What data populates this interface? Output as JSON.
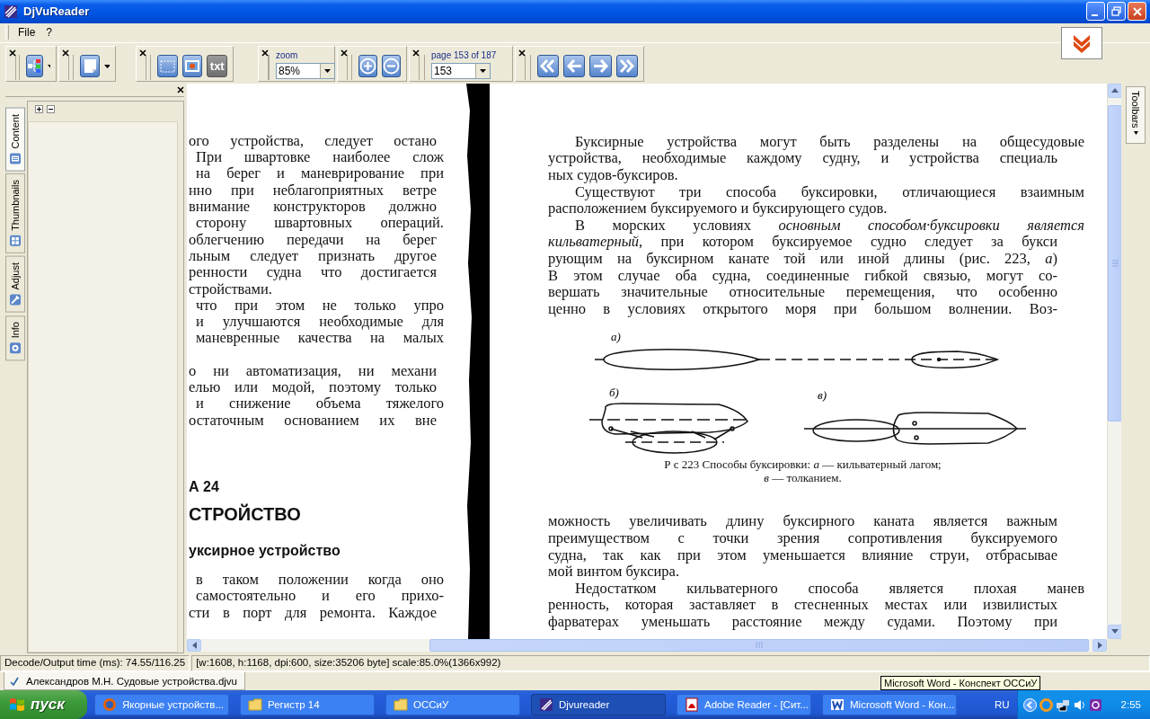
{
  "window": {
    "title": "DjVuReader"
  },
  "menu": [
    "File",
    "?"
  ],
  "toolbar": {
    "text_button": "txt",
    "zoom": {
      "label": "zoom",
      "value": "85%"
    },
    "page": {
      "label": "page 153 of 187",
      "value": "153"
    }
  },
  "sidebar": {
    "tabs": [
      {
        "label": "Content",
        "selected": true
      },
      {
        "label": "Thumbnails",
        "selected": false
      },
      {
        "label": "Adjust",
        "selected": false
      },
      {
        "label": "Info",
        "selected": false
      }
    ]
  },
  "right_tab": "Toolbars",
  "left_page": {
    "lines": [
      {
        "kind": "line",
        "text": "ого устройства, следует остано"
      },
      {
        "kind": "indent",
        "text": "При швартовке наиболее слож"
      },
      {
        "kind": "indent",
        "text": "на берег и маневрирование при"
      },
      {
        "kind": "line",
        "text": "нно при неблагоприятных ветре"
      },
      {
        "kind": "line",
        "text": "внимание конструкторов должно"
      },
      {
        "kind": "indent",
        "text": "сторону швартовных операций."
      },
      {
        "kind": "line",
        "text": "облегчению передачи на берег"
      },
      {
        "kind": "line",
        "text": "льным следует признать другое"
      },
      {
        "kind": "line",
        "text": "ренности судна что достигается"
      },
      {
        "kind": "end",
        "text": "стройствами."
      },
      {
        "kind": "indent",
        "text": "что при этом не только упро"
      },
      {
        "kind": "indent",
        "text": "и улучшаются необходимые для"
      },
      {
        "kind": "indent",
        "text": "маневренные качества на малых"
      },
      {
        "kind": "gap",
        "text": "о ни автоматизация, ни механи"
      },
      {
        "kind": "line",
        "text": "елью или модой, поэтому только"
      },
      {
        "kind": "indent",
        "text": "и снижение объема тяжелого"
      },
      {
        "kind": "line",
        "text": "остаточным основанием их вне"
      },
      {
        "kind": "chapter",
        "text": "А 24"
      },
      {
        "kind": "title",
        "text": "СТРОЙСТВО"
      },
      {
        "kind": "subtitle",
        "text": "уксирное устройство"
      },
      {
        "kind": "indent",
        "text": "в таком положении когда оно"
      },
      {
        "kind": "indent",
        "text": "самостоятельно и его прихо-"
      },
      {
        "kind": "line",
        "text": "сти в порт для ремонта. Каждое"
      }
    ]
  },
  "right_page": {
    "lines": [
      {
        "kind": "indent",
        "text": "Буксирные устройства могут быть разделены на общесудовые"
      },
      {
        "kind": "line",
        "text": "устройства, необходимые каждому судну, и устройства специаль"
      },
      {
        "kind": "end",
        "text": "ных судов-буксиров."
      },
      {
        "kind": "indent",
        "text": "Существуют три способа буксировки, отличающиеся взаимным"
      },
      {
        "kind": "end",
        "text": "расположением буксируемого и буксирующего судов."
      },
      {
        "kind": "indent",
        "text": "В морских условиях *основным способом·буксировки является*"
      },
      {
        "kind": "line",
        "text": "*кильватерный*, при котором буксируемое судно следует за букси"
      },
      {
        "kind": "line",
        "text": "рующим на буксирном канате той или иной длины (рис. 223, *а*)"
      },
      {
        "kind": "line",
        "text": "В этом случае оба судна, соединенные гибкой связью, могут со-"
      },
      {
        "kind": "line",
        "text": "вершать значительные относительные перемещения, что особенно"
      },
      {
        "kind": "line",
        "text": "ценно в условиях открытого моря при большом волнении. Воз-"
      }
    ],
    "figure": {
      "labels": [
        "а)",
        "б)",
        "в)"
      ],
      "caption": [
        "Р с 223 Способы буксировки: *а* — кильватерный лагом;",
        "*в* — толканием."
      ]
    },
    "lines_after": [
      {
        "kind": "line",
        "text": "можность увеличивать длину буксирного каната является важным"
      },
      {
        "kind": "line",
        "text": "преимуществом с точки зрения сопротивления буксируемого"
      },
      {
        "kind": "line",
        "text": "судна, так как при этом уменьшается влияние струи, отбрасывае"
      },
      {
        "kind": "end",
        "text": "мой винтом буксира."
      },
      {
        "kind": "indent",
        "text": "Недостатком кильватерного способа является плохая манев"
      },
      {
        "kind": "line",
        "text": "ренность, которая заставляет в стесненных местах или извилистых"
      },
      {
        "kind": "line",
        "text": "фарватерах уменьшать расстояние между судами. Поэтому при"
      }
    ]
  },
  "status_bar": [
    "Decode/Output time (ms): 74.55/116.25",
    "[w:1608, h:1168, dpi:600, size:35206 byte] scale:85.0%(1366x992)"
  ],
  "document_tab": "Александров М.Н. Судовые устройства.djvu",
  "tooltip": "Microsoft Word - Конспект ОССиУ",
  "taskbar": {
    "start": "пуск",
    "items": [
      {
        "kind": "browser",
        "label": "Якорные устройств...",
        "selected": false
      },
      {
        "kind": "folder",
        "label": "Регистр 14",
        "selected": false
      },
      {
        "kind": "folder",
        "label": "ОССиУ",
        "selected": false
      },
      {
        "kind": "reader",
        "label": "Djvureader",
        "selected": true
      },
      {
        "kind": "pdf",
        "label": "Adobe Reader - [Сит...",
        "selected": false
      },
      {
        "kind": "word",
        "label": "Microsoft Word - Кон...",
        "selected": false
      }
    ],
    "language": "RU",
    "clock": "2:55"
  }
}
